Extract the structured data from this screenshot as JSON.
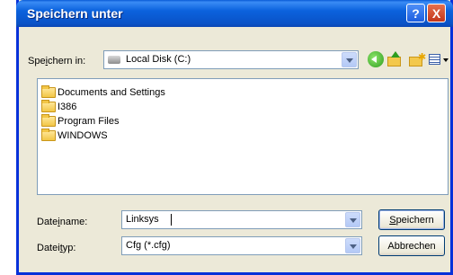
{
  "window": {
    "title": "Speichern unter"
  },
  "titlebar": {
    "help_glyph": "?",
    "close_glyph": "X"
  },
  "location": {
    "label_pre": "Spe",
    "label_ul": "i",
    "label_post": "chern in:",
    "value": "Local Disk (C:)",
    "icon": "disk-icon"
  },
  "toolbar": {
    "icons": [
      "back-icon",
      "up-folder-icon",
      "new-folder-icon",
      "views-menu-icon"
    ],
    "new_folder_glyph": "✱"
  },
  "files": [
    {
      "name": "Documents and Settings",
      "icon": "folder-icon"
    },
    {
      "name": "I386",
      "icon": "folder-icon"
    },
    {
      "name": "Program Files",
      "icon": "folder-icon"
    },
    {
      "name": "WINDOWS",
      "icon": "folder-icon"
    }
  ],
  "filename": {
    "label_pre": "Date",
    "label_ul": "i",
    "label_post": "name:",
    "value": "Linksys"
  },
  "filetype": {
    "label_pre": "Datei",
    "label_ul": "t",
    "label_post": "yp:",
    "value": "Cfg (*.cfg)"
  },
  "buttons": {
    "save_ul": "S",
    "save_rest": "peichern",
    "cancel": "Abbrechen"
  },
  "colors": {
    "titlebar": "#0a52c7",
    "window_bg": "#ece9d8",
    "border": "#0831d9",
    "field_border": "#7f9db9"
  }
}
